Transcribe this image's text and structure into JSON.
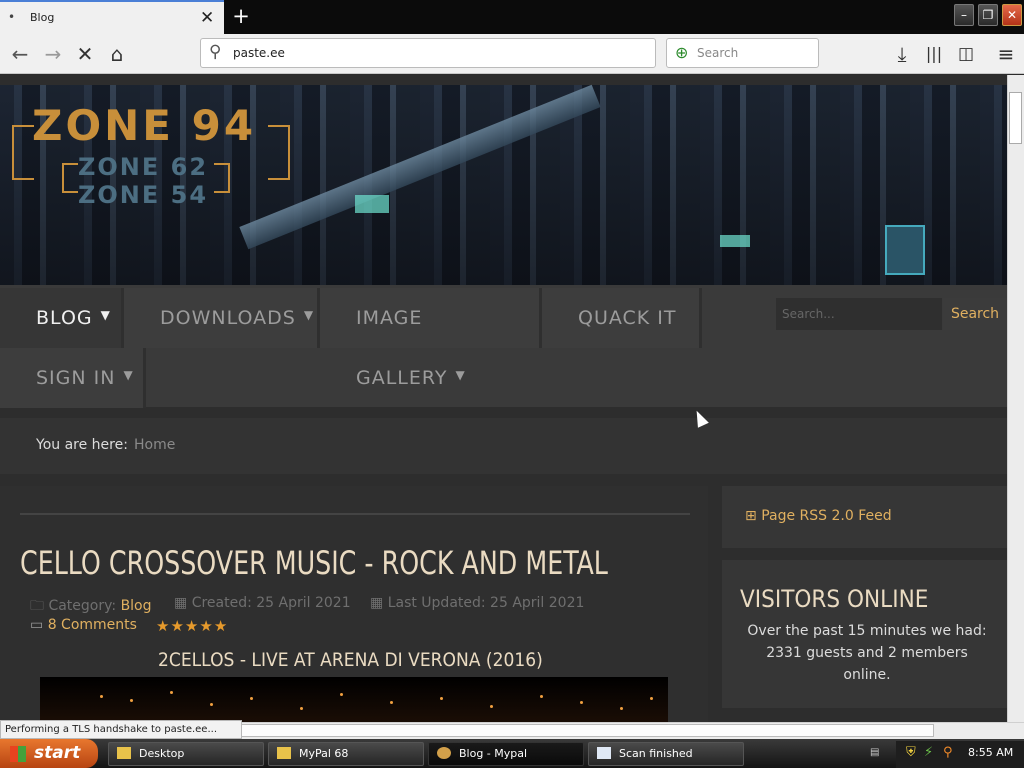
{
  "browser": {
    "tab_title": "Blog",
    "tab_dot": "•",
    "tab_close": "✕",
    "new_tab": "+",
    "url": "paste.ee",
    "search_placeholder": "Search",
    "status_text": "Performing a TLS handshake to paste.ee...",
    "window_buttons": [
      "–",
      "❐",
      "✕"
    ]
  },
  "site": {
    "logo_main": "ZONE 94",
    "logo_sub1": "ZONE 62",
    "logo_sub2": "ZONE 54",
    "menu": [
      {
        "label": "BLOG",
        "caret": "▼"
      },
      {
        "label": "DOWNLOADS",
        "caret": "▼"
      },
      {
        "label": "IMAGE GALLERY",
        "caret": "▼"
      },
      {
        "label": "QUACK IT",
        "caret": ""
      },
      {
        "label": "SIGN IN",
        "caret": "▼"
      }
    ],
    "search_placeholder": "Search...",
    "search_button": "Search",
    "breadcrumb_prefix": "You are here:",
    "breadcrumb_home": "Home"
  },
  "article": {
    "title": "CELLO CROSSOVER MUSIC - ROCK AND METAL",
    "category_label": "Category:",
    "category": "Blog",
    "created": "Created: 25 April 2021",
    "updated": "Last Updated: 25 April 2021",
    "comments": "8 Comments",
    "rating_stars": 5,
    "video_title": "2CELLOS - LIVE AT ARENA DI VERONA (2016)"
  },
  "sidebar": {
    "rss": "Page RSS 2.0 Feed",
    "visitors_title": "VISITORS ONLINE",
    "visitors_text": "Over the past 15 minutes we had: 2331 guests and 2 members online."
  },
  "taskbar": {
    "start": "start",
    "tasks": [
      "Desktop",
      "MyPal 68",
      "Blog - Mypal",
      "Scan finished"
    ],
    "clock": "8:55 AM"
  }
}
